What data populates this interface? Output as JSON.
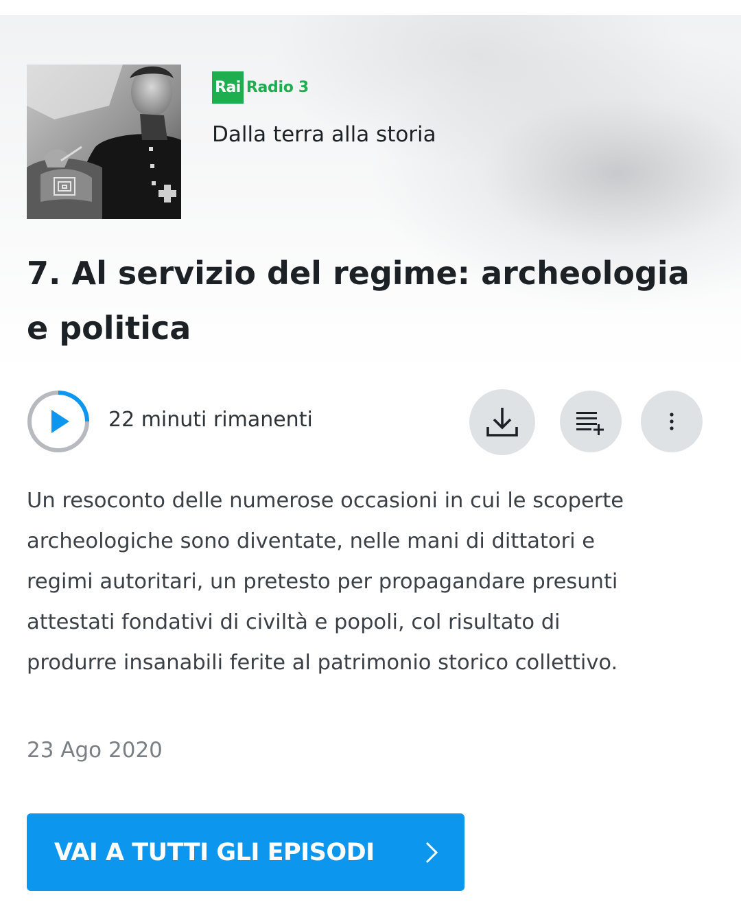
{
  "header": {
    "brand": {
      "box_text": "Rai",
      "name": "Radio 3",
      "color": "#1fae4f"
    },
    "show_title": "Dalla terra alla storia",
    "cover_icon": "podcast-cover-image"
  },
  "episode": {
    "title": "7. Al servizio del regime: archeologia e politica",
    "remaining": "22 minuti rimanenti",
    "progress_fraction": 0.25,
    "description": "Un resoconto delle numerose occasioni in cui le scoperte archeologiche sono diventate, nelle mani di dittatori e regimi autoritari, un pretesto per propagandare presunti attestati fondativi di civiltà e popoli, col risultato di produrre insanabili ferite al patrimonio storico collettivo.",
    "date": "23 Ago 2020"
  },
  "actions": {
    "play_icon": "play-icon",
    "download_icon": "download-icon",
    "queue_icon": "add-to-queue-icon",
    "more_icon": "more-vertical-icon"
  },
  "cta": {
    "label": "VAI A TUTTI GLI EPISODI",
    "icon": "chevron-right-icon",
    "color": "#0c96ee"
  },
  "colors": {
    "accent": "#0c96ee",
    "text": "#1c2126",
    "muted": "#7a7f84",
    "button_bg": "#dfe2e5"
  }
}
